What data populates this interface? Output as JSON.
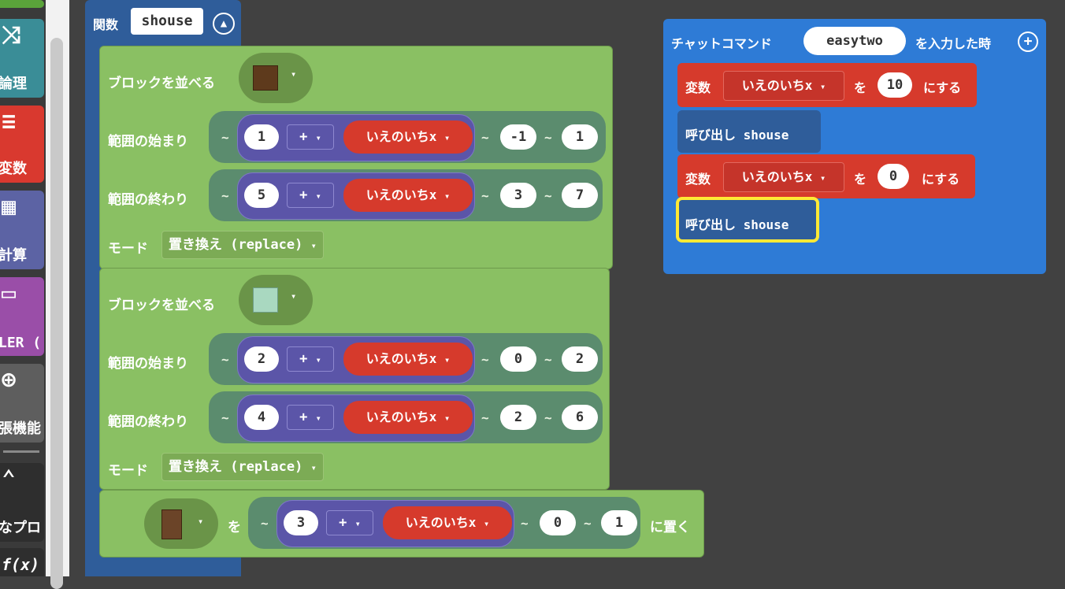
{
  "toolbox": {
    "categories": [
      {
        "label": "論理",
        "icon": "⤨",
        "color": "#3a8d97"
      },
      {
        "label": "変数",
        "icon": "≡",
        "color": "#d9392f"
      },
      {
        "label": "計算",
        "icon": "▦",
        "color": "#5c63a4"
      },
      {
        "label": "LER (",
        "icon": "▭",
        "color": "#9a4ea8"
      },
      {
        "label": "張機能",
        "icon": "⊕",
        "color": "#5e5e5e"
      },
      {
        "label": "なプロ",
        "icon": "⌃",
        "color": "#2e2e2e"
      },
      {
        "label": "",
        "icon": "f(x)",
        "color": "#2e2e2e"
      }
    ]
  },
  "function_block": {
    "label": "関数",
    "name": "shouse",
    "fill1": {
      "title": "ブロックを並べる",
      "start_label": "範囲の始まり",
      "start": {
        "base": "1",
        "op": "+",
        "var": "いえのいちx",
        "y": "-1",
        "z": "1"
      },
      "end_label": "範囲の終わり",
      "end": {
        "base": "5",
        "op": "+",
        "var": "いえのいちx",
        "y": "3",
        "z": "7"
      },
      "mode_label": "モード",
      "mode": "置き換え (replace)"
    },
    "fill2": {
      "title": "ブロックを並べる",
      "start_label": "範囲の始まり",
      "start": {
        "base": "2",
        "op": "+",
        "var": "いえのいちx",
        "y": "0",
        "z": "2"
      },
      "end_label": "範囲の終わり",
      "end": {
        "base": "4",
        "op": "+",
        "var": "いえのいちx",
        "y": "2",
        "z": "6"
      },
      "mode_label": "モード",
      "mode": "置き換え (replace)"
    },
    "place": {
      "wo": "を",
      "pos": {
        "base": "3",
        "op": "+",
        "var": "いえのいちx",
        "y": "0",
        "z": "1"
      },
      "suffix": "に置く"
    }
  },
  "chat_block": {
    "label": "チャットコマンド",
    "command": "easytwo",
    "suffix": "を入力した時",
    "set1": {
      "label": "変数",
      "var": "いえのいちx",
      "wo": "を",
      "value": "10",
      "suffix": "にする"
    },
    "call1": {
      "label": "呼び出し shouse"
    },
    "set2": {
      "label": "変数",
      "var": "いえのいちx",
      "wo": "を",
      "value": "0",
      "suffix": "にする"
    },
    "call2": {
      "label": "呼び出し shouse"
    }
  },
  "colors": {
    "function": "#2f5d9a",
    "chat": "#2e7bd6",
    "builder": "#8ac063",
    "variables": "#d63a2c",
    "math": "#5b55a8",
    "highlight": "#ffe935"
  },
  "symbols": {
    "tilde": "~",
    "caret": "▾"
  }
}
